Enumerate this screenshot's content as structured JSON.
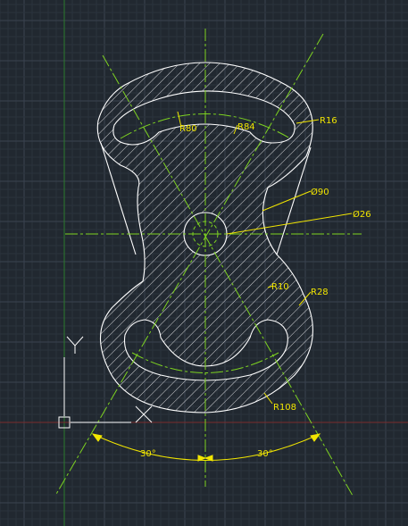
{
  "colors": {
    "background": "#212830",
    "grid_minor": "#2b333d",
    "grid_major": "#3a4350",
    "y_axis": "#2c7a2c",
    "x_axis": "#7a2c2c",
    "object": "#ffffff",
    "centerline": "#7ed321",
    "dimension": "#f2e600"
  },
  "dimensions": {
    "r80": "R80",
    "r84": "R84",
    "r16": "R16",
    "d90": "Ø90",
    "d26": "Ø26",
    "r10": "R10",
    "r28": "R28",
    "r108": "R108",
    "angle_left": "30°",
    "angle_right": "30°"
  },
  "ucs": {
    "x_label": "X",
    "y_label": "Y"
  }
}
